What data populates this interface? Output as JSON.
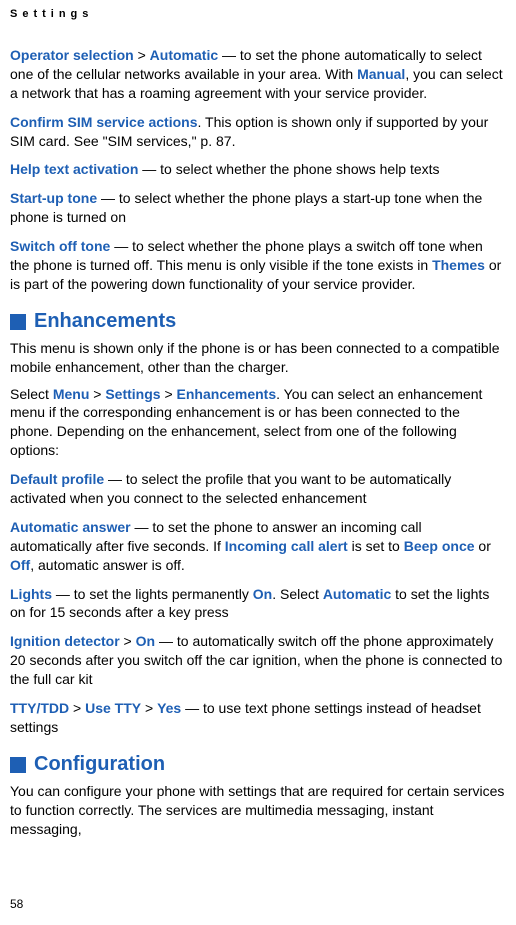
{
  "header": {
    "running": "Settings"
  },
  "page_number": "58",
  "sections": {
    "enhancements_title": "Enhancements",
    "configuration_title": "Configuration"
  },
  "t": {
    "p1_a": "Operator selection",
    "p1_b": " > ",
    "p1_c": "Automatic",
    "p1_d": " — to set the phone automatically to select one of the cellular networks available in your area. With ",
    "p1_e": "Manual",
    "p1_f": ", you can select a network that has a roaming agreement with your service provider.",
    "p2_a": "Confirm SIM service actions",
    "p2_b": ". This option is shown only if supported by your SIM card. See \"SIM services,\" p. 87.",
    "p3_a": "Help text activation",
    "p3_b": " — to select whether the phone shows help texts",
    "p4_a": "Start-up tone",
    "p4_b": " — to select whether the phone plays a start-up tone when the phone is turned on",
    "p5_a": "Switch off tone",
    "p5_b": " — to select whether the phone plays a switch off tone when the phone is turned off. This menu is only visible if the tone exists in ",
    "p5_c": "Themes",
    "p5_d": " or is part of the powering down functionality of your service provider.",
    "e1": "This menu is shown only if the phone is or has been connected to a compatible mobile enhancement, other than the charger.",
    "e2_a": "Select ",
    "e2_b": "Menu",
    "e2_c": " > ",
    "e2_d": "Settings",
    "e2_e": " > ",
    "e2_f": "Enhancements",
    "e2_g": ". You can select an enhancement menu if the corresponding enhancement is or has been connected to the phone. Depending on the enhancement, select from one of the following options:",
    "e3_a": "Default profile",
    "e3_b": " — to select the profile that you want to be automatically activated when you connect to the selected enhancement",
    "e4_a": "Automatic answer",
    "e4_b": " — to set the phone to answer an incoming call automatically after five seconds. If ",
    "e4_c": "Incoming call alert",
    "e4_d": " is set to ",
    "e4_e": "Beep once",
    "e4_f": " or ",
    "e4_g": "Off",
    "e4_h": ", automatic answer is off.",
    "e5_a": "Lights",
    "e5_b": " — to set the lights permanently ",
    "e5_c": "On",
    "e5_d": ". Select ",
    "e5_e": "Automatic",
    "e5_f": " to set the lights on for 15 seconds after a key press",
    "e6_a": "Ignition detector",
    "e6_b": " > ",
    "e6_c": "On",
    "e6_d": " — to automatically switch off the phone approximately 20 seconds after you switch off the car ignition, when the phone is connected to the full car kit",
    "e7_a": "TTY/TDD",
    "e7_b": " > ",
    "e7_c": "Use TTY",
    "e7_d": " > ",
    "e7_e": "Yes",
    "e7_f": " — to use text phone settings instead of headset settings",
    "c1": "You can configure your phone with settings that are required for certain services to function correctly. The services are multimedia messaging, instant messaging,"
  }
}
